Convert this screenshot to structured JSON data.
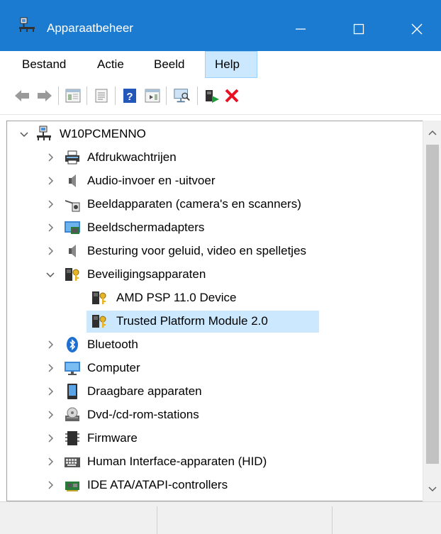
{
  "window": {
    "title": "Apparaatbeheer",
    "minimize_glyph": "—",
    "maximize_glyph": "☐",
    "close_glyph": "✕"
  },
  "menu": {
    "items": [
      "Bestand",
      "Actie",
      "Beeld",
      "Help"
    ],
    "active": "Help"
  },
  "toolbar": {
    "buttons": [
      "back-icon",
      "forward-icon",
      "show-hide-console-tree-icon",
      "properties-icon",
      "help-icon",
      "action-pane-icon",
      "monitor-scan-icon",
      "update-driver-icon",
      "uninstall-icon"
    ],
    "accent_colors": {
      "uninstall": "#e81123",
      "update": "#1e9e3a",
      "help": "#2458b8"
    }
  },
  "tree": {
    "root": "W10PCMENNO",
    "items": [
      {
        "label": "Afdrukwachtrijen",
        "icon": "printer-icon",
        "expanded": false
      },
      {
        "label": "Audio-invoer en -uitvoer",
        "icon": "speaker-icon",
        "expanded": false
      },
      {
        "label": "Beeldapparaten (camera's en scanners)",
        "icon": "camera-icon",
        "expanded": false
      },
      {
        "label": "Beeldschermadapters",
        "icon": "display-adapter-icon",
        "expanded": false
      },
      {
        "label": "Besturing voor geluid, video en spelletjes",
        "icon": "speaker-icon",
        "expanded": false
      },
      {
        "label": "Beveiligingsapparaten",
        "icon": "security-device-icon",
        "expanded": true
      },
      {
        "label": "AMD PSP 11.0 Device",
        "icon": "security-device-icon",
        "child": true
      },
      {
        "label": "Trusted Platform Module 2.0",
        "icon": "security-device-icon",
        "child": true,
        "selected": true
      },
      {
        "label": "Bluetooth",
        "icon": "bluetooth-icon",
        "expanded": false
      },
      {
        "label": "Computer",
        "icon": "computer-icon",
        "expanded": false
      },
      {
        "label": "Draagbare apparaten",
        "icon": "portable-device-icon",
        "expanded": false
      },
      {
        "label": "Dvd-/cd-rom-stations",
        "icon": "dvd-drive-icon",
        "expanded": false
      },
      {
        "label": "Firmware",
        "icon": "firmware-icon",
        "expanded": false
      },
      {
        "label": "Human Interface-apparaten (HID)",
        "icon": "hid-icon",
        "expanded": false
      },
      {
        "label": "IDE ATA/ATAPI-controllers",
        "icon": "ide-controller-icon",
        "expanded": false
      }
    ]
  },
  "colors": {
    "titlebar": "#1a7bd0",
    "selection": "#cce8ff",
    "menu_hover_border": "#99d1ff"
  }
}
